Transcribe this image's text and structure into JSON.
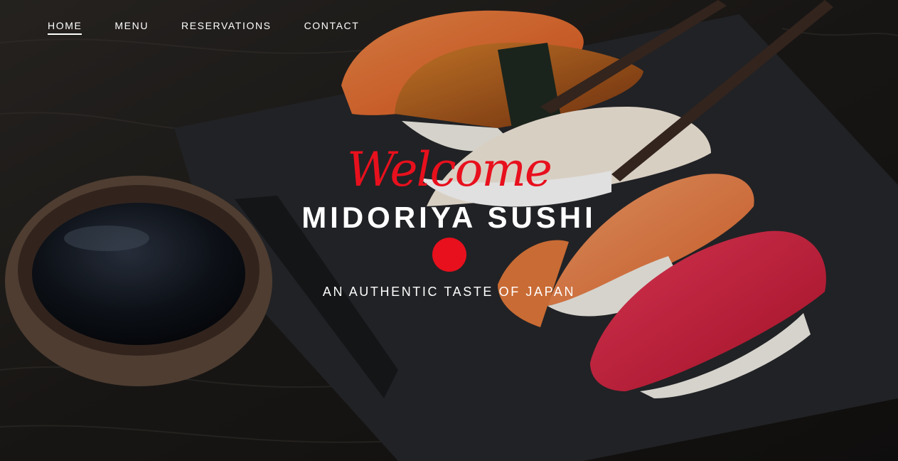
{
  "nav": {
    "items": [
      {
        "label": "HOME",
        "active": true
      },
      {
        "label": "MENU",
        "active": false
      },
      {
        "label": "RESERVATIONS",
        "active": false
      },
      {
        "label": "CONTACT",
        "active": false
      }
    ]
  },
  "hero": {
    "welcome": "Welcome",
    "title": "MIDORIYA SUSHI",
    "tagline": "AN AUTHENTIC TASTE OF JAPAN"
  },
  "colors": {
    "accent": "#e8101d",
    "text": "#ffffff"
  }
}
